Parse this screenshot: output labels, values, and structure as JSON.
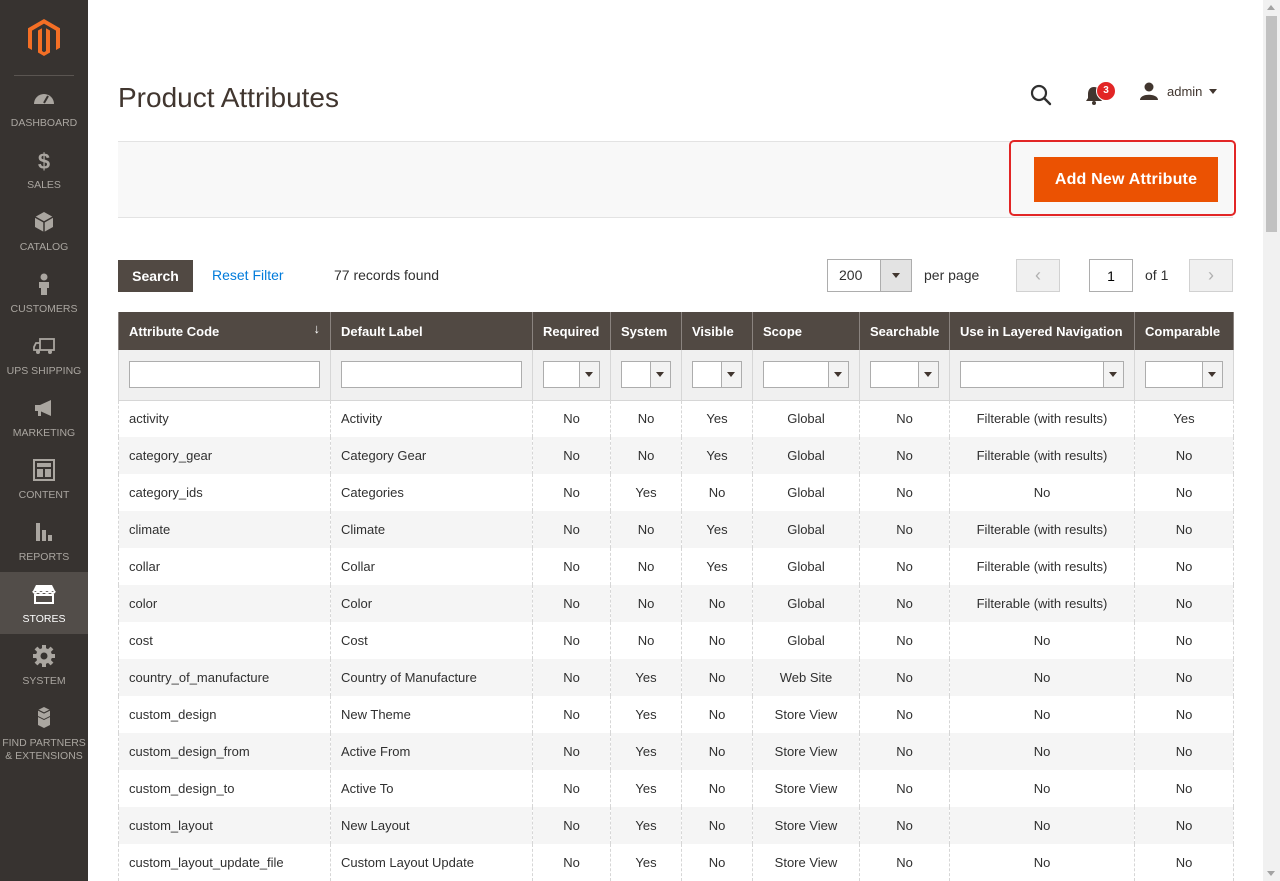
{
  "sidebar": {
    "items": [
      {
        "label": "DASHBOARD",
        "icon": "dashboard-icon"
      },
      {
        "label": "SALES",
        "icon": "dollar-icon"
      },
      {
        "label": "CATALOG",
        "icon": "cube-icon"
      },
      {
        "label": "CUSTOMERS",
        "icon": "person-icon"
      },
      {
        "label": "UPS SHIPPING",
        "icon": "truck-icon"
      },
      {
        "label": "MARKETING",
        "icon": "megaphone-icon"
      },
      {
        "label": "CONTENT",
        "icon": "layout-icon"
      },
      {
        "label": "REPORTS",
        "icon": "bar-chart-icon"
      },
      {
        "label": "STORES",
        "icon": "storefront-icon"
      },
      {
        "label": "SYSTEM",
        "icon": "gear-icon"
      },
      {
        "label": "FIND PARTNERS & EXTENSIONS",
        "icon": "boxes-icon"
      }
    ],
    "active": "STORES"
  },
  "header": {
    "title": "Product Attributes",
    "notifications": "3",
    "user": "admin"
  },
  "actions": {
    "add_label": "Add New Attribute"
  },
  "toolbar": {
    "search_label": "Search",
    "reset_label": "Reset Filter",
    "records": "77 records found",
    "per_page_value": "200",
    "per_page_label": "per page",
    "page_value": "1",
    "page_of": "of 1"
  },
  "grid": {
    "columns": [
      "Attribute Code",
      "Default Label",
      "Required",
      "System",
      "Visible",
      "Scope",
      "Searchable",
      "Use in Layered Navigation",
      "Comparable"
    ],
    "sort_indicator": "↓",
    "rows": [
      [
        "activity",
        "Activity",
        "No",
        "No",
        "Yes",
        "Global",
        "No",
        "Filterable (with results)",
        "Yes"
      ],
      [
        "category_gear",
        "Category Gear",
        "No",
        "No",
        "Yes",
        "Global",
        "No",
        "Filterable (with results)",
        "No"
      ],
      [
        "category_ids",
        "Categories",
        "No",
        "Yes",
        "No",
        "Global",
        "No",
        "No",
        "No"
      ],
      [
        "climate",
        "Climate",
        "No",
        "No",
        "Yes",
        "Global",
        "No",
        "Filterable (with results)",
        "No"
      ],
      [
        "collar",
        "Collar",
        "No",
        "No",
        "Yes",
        "Global",
        "No",
        "Filterable (with results)",
        "No"
      ],
      [
        "color",
        "Color",
        "No",
        "No",
        "No",
        "Global",
        "No",
        "Filterable (with results)",
        "No"
      ],
      [
        "cost",
        "Cost",
        "No",
        "No",
        "No",
        "Global",
        "No",
        "No",
        "No"
      ],
      [
        "country_of_manufacture",
        "Country of Manufacture",
        "No",
        "Yes",
        "No",
        "Web Site",
        "No",
        "No",
        "No"
      ],
      [
        "custom_design",
        "New Theme",
        "No",
        "Yes",
        "No",
        "Store View",
        "No",
        "No",
        "No"
      ],
      [
        "custom_design_from",
        "Active From",
        "No",
        "Yes",
        "No",
        "Store View",
        "No",
        "No",
        "No"
      ],
      [
        "custom_design_to",
        "Active To",
        "No",
        "Yes",
        "No",
        "Store View",
        "No",
        "No",
        "No"
      ],
      [
        "custom_layout",
        "New Layout",
        "No",
        "Yes",
        "No",
        "Store View",
        "No",
        "No",
        "No"
      ],
      [
        "custom_layout_update_file",
        "Custom Layout Update",
        "No",
        "Yes",
        "No",
        "Store View",
        "No",
        "No",
        "No"
      ]
    ]
  },
  "colors": {
    "accent": "#eb5202",
    "sidebar": "#373330",
    "header_row": "#514943",
    "link": "#007bdb",
    "highlight": "#e22626"
  }
}
